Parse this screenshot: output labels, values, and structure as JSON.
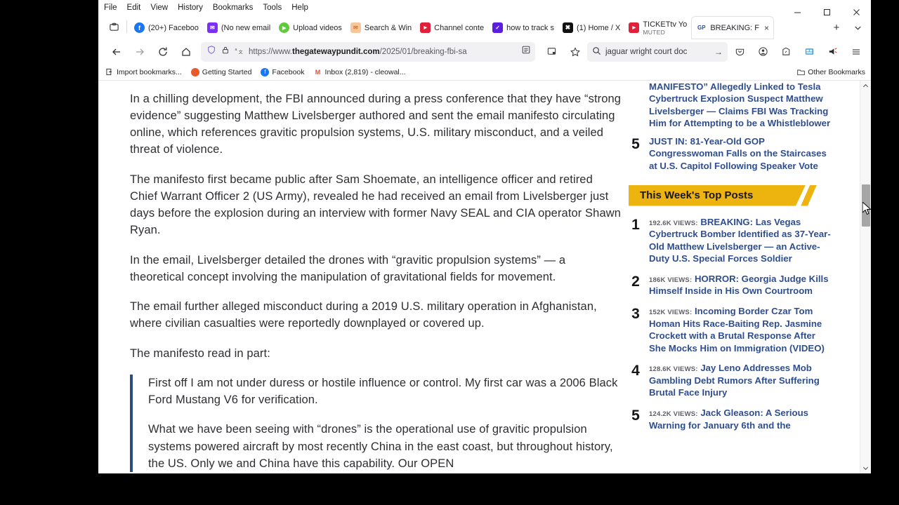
{
  "menubar": {
    "items": [
      "File",
      "Edit",
      "View",
      "History",
      "Bookmarks",
      "Tools",
      "Help"
    ]
  },
  "window_controls": {
    "minimize": "minimize-label",
    "maximize": "maximize-label",
    "close": "close-label"
  },
  "tabs": [
    {
      "label": "(20+) Faceboo",
      "sub": "",
      "favicon": "facebook-icon",
      "color": "#1877f2",
      "glyph": "f",
      "active": false
    },
    {
      "label": "(No new email",
      "sub": "",
      "favicon": "mail-icon",
      "color": "#7b2ff7",
      "glyph": "✉",
      "active": false
    },
    {
      "label": "Upload videos",
      "sub": "",
      "favicon": "play-icon",
      "color": "#5ecb3a",
      "glyph": "▶",
      "active": false
    },
    {
      "label": "Search & Win",
      "sub": "",
      "favicon": "envelope-orange-icon",
      "color": "#f0a868",
      "glyph": "✉",
      "active": false
    },
    {
      "label": "Channel conte",
      "sub": "",
      "favicon": "youtube-icon",
      "color": "#e0213a",
      "glyph": "▶",
      "active": false
    },
    {
      "label": "how to track s",
      "sub": "",
      "favicon": "chart-icon",
      "color": "#5b1de0",
      "glyph": "✓",
      "active": false
    },
    {
      "label": "(1) Home / X",
      "sub": "",
      "favicon": "x-icon",
      "color": "#111111",
      "glyph": "𝕏",
      "active": false
    },
    {
      "label": "TICKETtv  You",
      "sub": "MUTED",
      "favicon": "youtube-icon",
      "color": "#e0213a",
      "glyph": "▶",
      "active": false
    },
    {
      "label": "BREAKING: F",
      "sub": "",
      "favicon": "gp-icon",
      "color": "#ffffff",
      "glyph": "GP",
      "active": true
    }
  ],
  "tab_controls": {
    "list_all": "list-all-tabs",
    "new_tab": "+",
    "close_tab": "×",
    "dropdown": "⌄"
  },
  "navbar": {
    "back": "←",
    "forward": "→",
    "reload": "↻",
    "home": "home-icon",
    "shield": "shield-icon",
    "lock": "lock-icon",
    "translate": "translate-icon",
    "url_prefix": "https://www.",
    "url_domain": "thegatewaypundit.com",
    "url_path": "/2025/01/breaking-fbi-sa",
    "reader": "reader-view-icon",
    "screenshot": "screenshot-icon",
    "bookmark_star": "bookmark-star-icon",
    "search_value": "jaguar wright court doc",
    "search_go": "→",
    "search_icon": "search-icon"
  },
  "toolbar_icons": [
    {
      "name": "pocket-icon",
      "glyph": "♡"
    },
    {
      "name": "account-icon",
      "glyph": "●"
    },
    {
      "name": "extension-icon",
      "glyph": "⬠"
    },
    {
      "name": "news-extension-icon",
      "glyph": "☷"
    },
    {
      "name": "megaphone-extension-icon",
      "glyph": "◤"
    },
    {
      "name": "app-menu-icon",
      "glyph": "≡"
    }
  ],
  "bookmarks": [
    {
      "label": "Import bookmarks...",
      "icon": "import-icon",
      "color": "#ffffff",
      "glyph": "⇥"
    },
    {
      "label": "Getting Started",
      "icon": "firefox-icon",
      "color": "#e55b2b",
      "glyph": "●"
    },
    {
      "label": "Facebook",
      "icon": "facebook-icon",
      "color": "#1877f2",
      "glyph": "f"
    },
    {
      "label": "Inbox (2,819) - cleowal...",
      "icon": "gmail-icon",
      "color": "#ea4335",
      "glyph": "M"
    }
  ],
  "bookmarks_right": {
    "label": "Other Bookmarks",
    "icon": "folder-icon",
    "glyph": "🗀"
  },
  "article": {
    "paragraphs": [
      "In a chilling development, the FBI announced during a press conference that they have “strong evidence” suggesting Matthew Livelsberger authored and sent the email manifesto circulating online, which references gravitic propulsion systems, U.S. military misconduct, and a veiled threat of violence.",
      "The manifesto first became public after Sam Shoemate, an intelligence officer and retired Chief Warrant Officer 2 (US Army), revealed he had received an email from Livelsberger just days before the explosion during an interview with former Navy SEAL and CIA operator Shawn Ryan.",
      "In the email, Livelsberger detailed the drones with “gravitic propulsion systems” — a theoretical concept involving the manipulation of gravitational fields for movement.",
      "The email further alleged misconduct during a 2019 U.S. military operation in Afghanistan, where civilian casualties were reportedly downplayed or covered up.",
      "The manifesto read in part:"
    ],
    "quote_paragraphs": [
      "First off I am not under duress or hostile influence or control. My first car was a 2006 Black Ford Mustang V6 for verification.",
      "What we have been seeing with “drones” is the operational use of gravitic propulsion systems powered aircraft by most recently China in the east coast, but throughout history, the US. Only we and China have this capability. Our OPEN"
    ]
  },
  "sidebar": {
    "partial_top": {
      "rank": "",
      "text": "MANIFESTO” Allegedly Linked to Tesla Cybertruck Explosion Suspect Matthew Livelsberger — Claims FBI Was Tracking Him for Attempting to be a Whistleblower"
    },
    "partial_second": {
      "rank": "5",
      "text": "JUST IN: 81-Year-Old GOP Congresswoman Falls on the Staircases at U.S. Capitol Following Speaker Vote"
    },
    "banner_title": "This Week's Top Posts",
    "banner_bg": "#edb30f",
    "link_color": "#2f4e8f",
    "top_posts": [
      {
        "rank": "1",
        "views": "192.6K VIEWS:",
        "title": "BREAKING: Las Vegas Cybertruck Bomber Identified as 37-Year-Old Matthew Livelsberger — an Active-Duty U.S. Special Forces Soldier"
      },
      {
        "rank": "2",
        "views": "186K VIEWS:",
        "title": "HORROR: Georgia Judge Kills Himself Inside in His Own Courtroom"
      },
      {
        "rank": "3",
        "views": "152K VIEWS:",
        "title": "Incoming Border Czar Tom Homan Hits Race-Baiting Rep. Jasmine Crockett with a Brutal Response After She Mocks Him on Immigration (VIDEO)"
      },
      {
        "rank": "4",
        "views": "128.6K VIEWS:",
        "title": "Jay Leno Addresses Mob Gambling Debt Rumors After Suffering Brutal Face Injury"
      },
      {
        "rank": "5",
        "views": "124.2K VIEWS:",
        "title": "Jack Gleason: A Serious Warning for January 6th and the"
      }
    ]
  },
  "scrollbar": {
    "up": "⌃",
    "down": "⌄"
  }
}
